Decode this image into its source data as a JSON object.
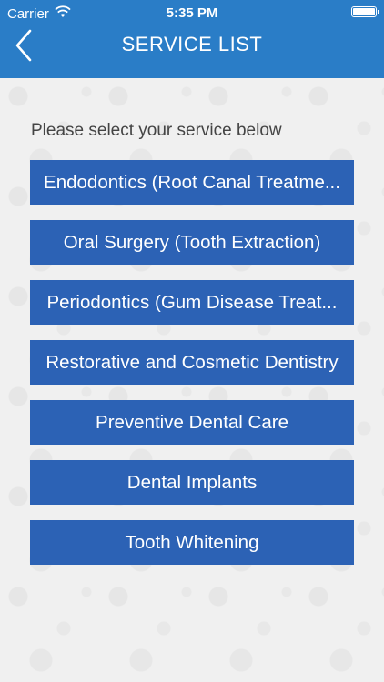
{
  "status_bar": {
    "carrier": "Carrier",
    "time": "5:35 PM"
  },
  "header": {
    "title": "SERVICE LIST",
    "back_icon": "chevron-left-icon"
  },
  "instruction": "Please select your service below",
  "services": [
    "Endodontics (Root Canal Treatme...",
    "Oral Surgery (Tooth Extraction)",
    "Periodontics (Gum Disease Treat...",
    "Restorative and Cosmetic Dentistry",
    "Preventive Dental Care",
    "Dental Implants",
    "Tooth Whitening"
  ],
  "colors": {
    "header": "#2a7dc7",
    "button": "#2c62b5"
  }
}
